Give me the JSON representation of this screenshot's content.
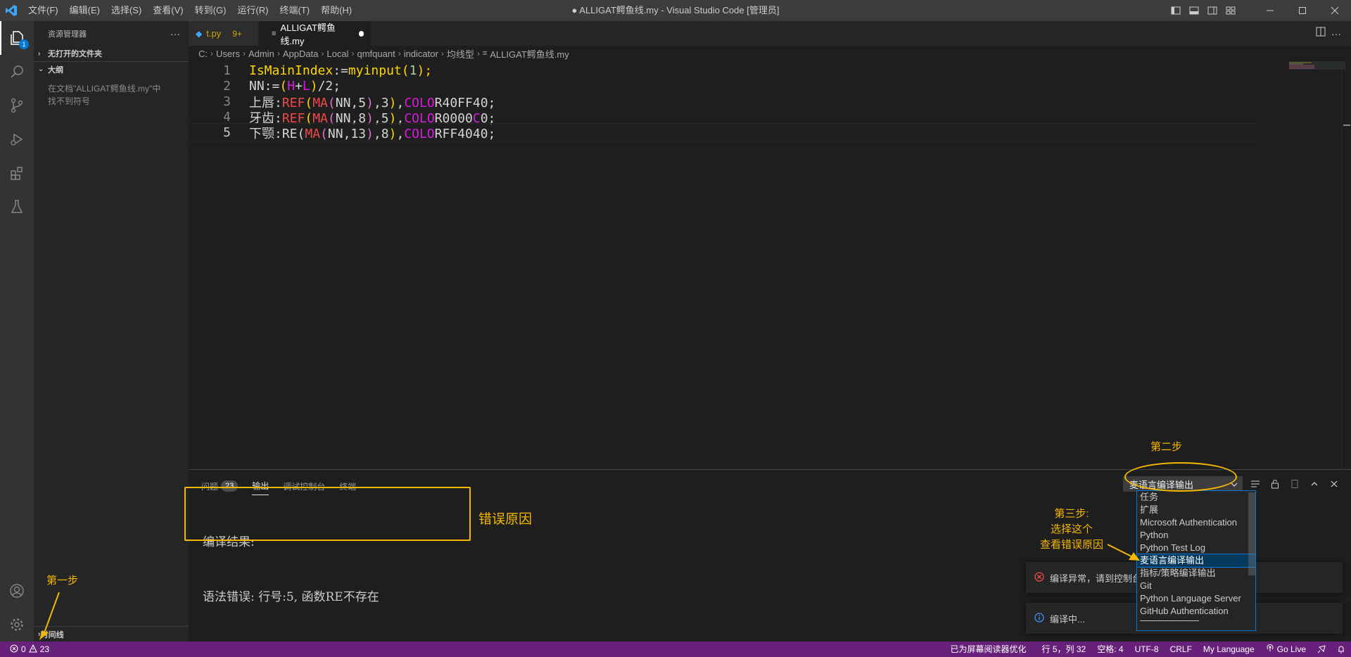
{
  "titlebar": {
    "menu": [
      "文件(F)",
      "编辑(E)",
      "选择(S)",
      "查看(V)",
      "转到(G)",
      "运行(R)",
      "终端(T)",
      "帮助(H)"
    ],
    "title": "● ALLIGAT鳄鱼线.my - Visual Studio Code [管理员]"
  },
  "activitybar": {
    "explorer_badge": "1"
  },
  "sidebar": {
    "header": "资源管理器",
    "more": "···",
    "no_folder": "无打开的文件夹",
    "outline": "大纲",
    "outline_msg_1": "在文档\"ALLIGAT鳄鱼线.my\"中",
    "outline_msg_2": "找不到符号",
    "timeline": "时间线"
  },
  "tabs": [
    {
      "label": "t.py",
      "errors": "9+"
    },
    {
      "label": "ALLIGAT鳄鱼线.my"
    }
  ],
  "breadcrumb": [
    "C:",
    "Users",
    "Admin",
    "AppData",
    "Local",
    "qmfquant",
    "indicator",
    "均线型",
    "ALLIGAT鳄鱼线.my"
  ],
  "editor": {
    "line_numbers": [
      "1",
      "2",
      "3",
      "4",
      "5"
    ],
    "l1": {
      "a": "IsMainIndex",
      "b": ":=",
      "c": "myinput",
      "d": "(",
      "e": "1",
      "f": ");"
    },
    "l2": {
      "a": "NN:=",
      "b": "(",
      "c": "H",
      "d": "+",
      "e": "L",
      "f": ")",
      "g": "/2;"
    },
    "l3": {
      "a": "上唇:",
      "b": "REF",
      "c": "(",
      "d": "MA",
      "e": "(",
      "f": "NN,5",
      "g": ")",
      "h": ",3",
      "i": ")",
      "j": ",",
      "k": "COLO",
      "l": "R40FF40;"
    },
    "l4": {
      "a": "牙齿:",
      "b": "REF",
      "c": "(",
      "d": "MA",
      "e": "(",
      "f": "NN,8",
      "g": ")",
      "h": ",5",
      "i": ")",
      "j": ",",
      "k": "COLO",
      "l": "R0000",
      "m": "C",
      "n": "0;"
    },
    "l5": {
      "a": "下颚:RE(",
      "b": "MA",
      "c": "(",
      "d": "NN,13",
      "e": ")",
      "f": ",8",
      "g": ")",
      "h": ",",
      "i": "COLO",
      "j": "RFF4040;"
    }
  },
  "panel": {
    "tabs": [
      {
        "label": "问题",
        "count": "23"
      },
      {
        "label": "输出"
      },
      {
        "label": "调试控制台"
      },
      {
        "label": "终端"
      }
    ],
    "select_value": "麦语言编译输出",
    "output_line1": "编译结果:",
    "output_line2": "语法错误: 行号:5, 函数RE不存在"
  },
  "dropdown_options": [
    "任务",
    "扩展",
    "Microsoft Authentication",
    "Python",
    "Python Test Log",
    "麦语言编译输出",
    "指标/策略编译输出",
    "Git",
    "Python Language Server",
    "GitHub Authentication"
  ],
  "notifications": {
    "error": "编译异常，请到控制台",
    "info": "编译中..."
  },
  "statusbar": {
    "errors": "0",
    "warnings": "23",
    "screen_reader": "已为屏幕阅读器优化",
    "position": "行 5，列 32",
    "spaces": "空格: 4",
    "encoding": "UTF-8",
    "eol": "CRLF",
    "language": "My Language",
    "golive": "Go Live"
  },
  "annotations": {
    "step1": "第一步",
    "step2": "第二步",
    "step3_1": "第三步:",
    "step3_2": "选择这个",
    "step3_3": "查看错误原因",
    "reason": "错误原因"
  },
  "colors": {
    "statusbar": "#68217a",
    "annotation": "#f5b800",
    "accent": "#0078d4"
  }
}
